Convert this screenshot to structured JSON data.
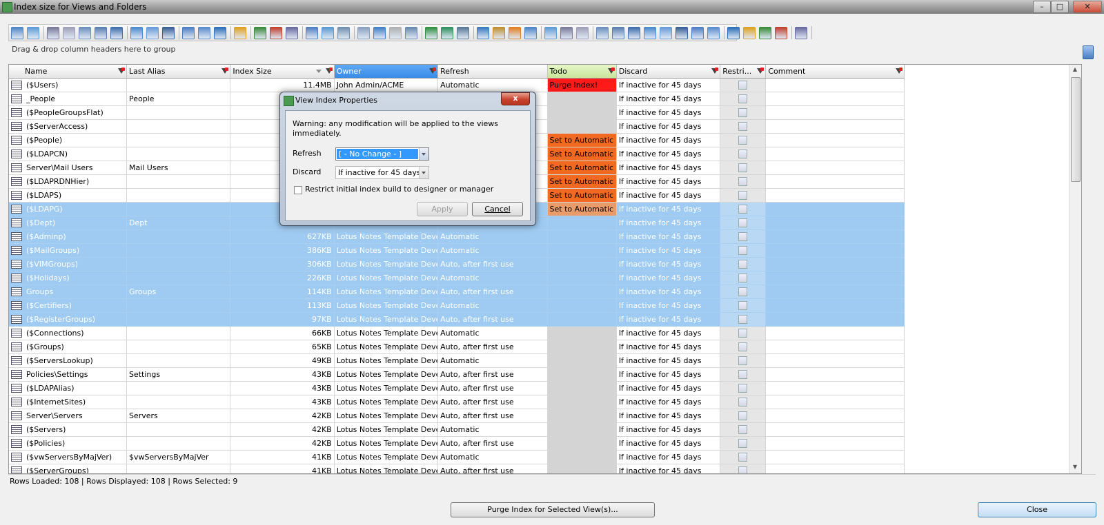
{
  "window": {
    "title": "Index size for Views and Folders"
  },
  "group_hint": "Drag & drop column headers here to group",
  "columns": [
    "Name",
    "Last Alias",
    "Index Size",
    "Owner",
    "Refresh",
    "Todo",
    "Discard",
    "Restri...",
    "Comment"
  ],
  "rows": [
    {
      "name": "($Users)",
      "alias": "",
      "size": "11.4MB",
      "owner": "John Admin/ACME",
      "refresh": "Automatic",
      "todo": "Purge Index!",
      "discard": "If inactive for 45 days",
      "sel": false,
      "todo_style": "red"
    },
    {
      "name": "_People",
      "alias": "People",
      "size": "",
      "owner": "",
      "refresh": "",
      "todo": "",
      "discard": "If inactive for 45 days",
      "sel": false,
      "todo_style": ""
    },
    {
      "name": "($PeopleGroupsFlat)",
      "alias": "",
      "size": "",
      "owner": "",
      "refresh": "",
      "todo": "",
      "discard": "If inactive for 45 days",
      "sel": false,
      "todo_style": ""
    },
    {
      "name": "($ServerAccess)",
      "alias": "",
      "size": "",
      "owner": "",
      "refresh": "",
      "todo": "",
      "discard": "If inactive for 45 days",
      "sel": false,
      "todo_style": ""
    },
    {
      "name": "($People)",
      "alias": "",
      "size": "",
      "owner": "",
      "refresh": "",
      "todo": "Set to Automatic",
      "discard": "If inactive for 45 days",
      "sel": false,
      "todo_style": "orange"
    },
    {
      "name": "($LDAPCN)",
      "alias": "",
      "size": "",
      "owner": "",
      "refresh": "",
      "todo": "Set to Automatic",
      "discard": "If inactive for 45 days",
      "sel": false,
      "todo_style": "orange"
    },
    {
      "name": "Server\\Mail Users",
      "alias": "Mail Users",
      "size": "",
      "owner": "",
      "refresh": "",
      "todo": "Set to Automatic",
      "discard": "If inactive for 45 days",
      "sel": false,
      "todo_style": "orange"
    },
    {
      "name": "($LDAPRDNHier)",
      "alias": "",
      "size": "",
      "owner": "",
      "refresh": "",
      "todo": "Set to Automatic",
      "discard": "If inactive for 45 days",
      "sel": false,
      "todo_style": "orange"
    },
    {
      "name": "($LDAPS)",
      "alias": "",
      "size": "",
      "owner": "",
      "refresh": "",
      "todo": "Set to Automatic",
      "discard": "If inactive for 45 days",
      "sel": false,
      "todo_style": "orange"
    },
    {
      "name": "($LDAPG)",
      "alias": "",
      "size": "",
      "owner": "",
      "refresh": "",
      "todo": "Set to Automatic",
      "discard": "If inactive for 45 days",
      "sel": true,
      "todo_style": "orange"
    },
    {
      "name": "($Dept)",
      "alias": "Dept",
      "size": "",
      "owner": "",
      "refresh": "",
      "todo": "",
      "discard": "If inactive for 45 days",
      "sel": true,
      "todo_style": ""
    },
    {
      "name": "($Adminp)",
      "alias": "",
      "size": "627KB",
      "owner": "Lotus Notes Template Deve",
      "refresh": "Automatic",
      "todo": "",
      "discard": "If inactive for 45 days",
      "sel": true,
      "todo_style": ""
    },
    {
      "name": "($MailGroups)",
      "alias": "",
      "size": "386KB",
      "owner": "Lotus Notes Template Deve",
      "refresh": "Automatic",
      "todo": "",
      "discard": "If inactive for 45 days",
      "sel": true,
      "todo_style": ""
    },
    {
      "name": "($VIMGroups)",
      "alias": "",
      "size": "306KB",
      "owner": "Lotus Notes Template Deve",
      "refresh": "Auto, after first use",
      "todo": "",
      "discard": "If inactive for 45 days",
      "sel": true,
      "todo_style": ""
    },
    {
      "name": "($Holidays)",
      "alias": "",
      "size": "226KB",
      "owner": "Lotus Notes Template Deve",
      "refresh": "Automatic",
      "todo": "",
      "discard": "If inactive for 45 days",
      "sel": true,
      "todo_style": ""
    },
    {
      "name": "Groups",
      "alias": "Groups",
      "size": "114KB",
      "owner": "Lotus Notes Template Deve",
      "refresh": "Auto, after first use",
      "todo": "",
      "discard": "If inactive for 45 days",
      "sel": true,
      "todo_style": ""
    },
    {
      "name": "($Certifiers)",
      "alias": "",
      "size": "113KB",
      "owner": "Lotus Notes Template Deve",
      "refresh": "Automatic",
      "todo": "",
      "discard": "If inactive for 45 days",
      "sel": true,
      "todo_style": ""
    },
    {
      "name": "($RegisterGroups)",
      "alias": "",
      "size": "97KB",
      "owner": "Lotus Notes Template Deve",
      "refresh": "Auto, after first use",
      "todo": "",
      "discard": "If inactive for 45 days",
      "sel": true,
      "todo_style": ""
    },
    {
      "name": "($Connections)",
      "alias": "",
      "size": "66KB",
      "owner": "Lotus Notes Template Deve",
      "refresh": "Automatic",
      "todo": "",
      "discard": "If inactive for 45 days",
      "sel": false,
      "todo_style": ""
    },
    {
      "name": "($Groups)",
      "alias": "",
      "size": "65KB",
      "owner": "Lotus Notes Template Deve",
      "refresh": "Auto, after first use",
      "todo": "",
      "discard": "If inactive for 45 days",
      "sel": false,
      "todo_style": ""
    },
    {
      "name": "($ServersLookup)",
      "alias": "",
      "size": "49KB",
      "owner": "Lotus Notes Template Deve",
      "refresh": "Automatic",
      "todo": "",
      "discard": "If inactive for 45 days",
      "sel": false,
      "todo_style": ""
    },
    {
      "name": "Policies\\Settings",
      "alias": "Settings",
      "size": "43KB",
      "owner": "Lotus Notes Template Deve",
      "refresh": "Auto, after first use",
      "todo": "",
      "discard": "If inactive for 45 days",
      "sel": false,
      "todo_style": ""
    },
    {
      "name": "($LDAPAlias)",
      "alias": "",
      "size": "43KB",
      "owner": "Lotus Notes Template Deve",
      "refresh": "Auto, after first use",
      "todo": "",
      "discard": "If inactive for 45 days",
      "sel": false,
      "todo_style": ""
    },
    {
      "name": "($InternetSites)",
      "alias": "",
      "size": "43KB",
      "owner": "Lotus Notes Template Deve",
      "refresh": "Auto, after first use",
      "todo": "",
      "discard": "If inactive for 45 days",
      "sel": false,
      "todo_style": ""
    },
    {
      "name": "Server\\Servers",
      "alias": "Servers",
      "size": "42KB",
      "owner": "Lotus Notes Template Deve",
      "refresh": "Auto, after first use",
      "todo": "",
      "discard": "If inactive for 45 days",
      "sel": false,
      "todo_style": ""
    },
    {
      "name": "($Servers)",
      "alias": "",
      "size": "42KB",
      "owner": "Lotus Notes Template Deve",
      "refresh": "Automatic",
      "todo": "",
      "discard": "If inactive for 45 days",
      "sel": false,
      "todo_style": ""
    },
    {
      "name": "($Policies)",
      "alias": "",
      "size": "42KB",
      "owner": "Lotus Notes Template Deve",
      "refresh": "Auto, after first use",
      "todo": "",
      "discard": "If inactive for 45 days",
      "sel": false,
      "todo_style": ""
    },
    {
      "name": "($vwServersByMajVer)",
      "alias": "$vwServersByMajVer",
      "size": "41KB",
      "owner": "Lotus Notes Template Deve",
      "refresh": "Automatic",
      "todo": "",
      "discard": "If inactive for 45 days",
      "sel": false,
      "todo_style": ""
    },
    {
      "name": "($ServerGroups)",
      "alias": "",
      "size": "41KB",
      "owner": "Lotus Notes Template Deve",
      "refresh": "Auto, after first use",
      "todo": "",
      "discard": "If inactive for 45 days",
      "sel": false,
      "todo_style": ""
    }
  ],
  "status": "Rows Loaded: 108  |  Rows Displayed: 108  |  Rows Selected: 9",
  "buttons": {
    "purge": "Purge Index for Selected View(s)...",
    "close": "Close"
  },
  "dialog": {
    "title": "View Index Properties",
    "warning": "Warning: any modification will be applied to the views immediately.",
    "refresh_label": "Refresh",
    "refresh_value": "[ - No Change - ]",
    "discard_label": "Discard",
    "discard_value": "If inactive for 45 days",
    "restrict_label": "Restrict initial index build to designer or manager",
    "apply": "Apply",
    "cancel": "Cancel",
    "close_glyph": "x"
  },
  "window_controls": [
    "–",
    "□",
    "✕"
  ]
}
